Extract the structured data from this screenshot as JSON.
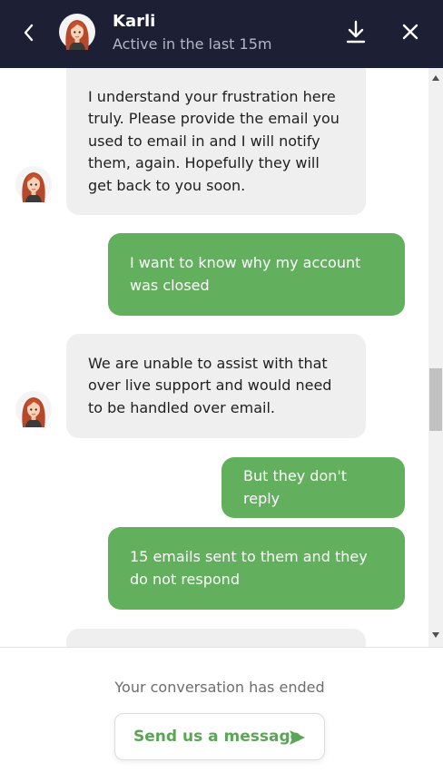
{
  "header": {
    "agent_name": "Karli",
    "status": "Active in the last 15m",
    "background_color": "#1d2035"
  },
  "messages": [
    {
      "sender": "agent",
      "text": "I understand your frustration here truly. Please provide the email you used to email in and I will notify them, again. Hopefully they will get back to you soon."
    },
    {
      "sender": "user",
      "text": "I want to know why my account was closed"
    },
    {
      "sender": "agent",
      "text": "We are unable to assist with that over live support and would need to be handled over email."
    },
    {
      "sender": "user",
      "text": "But they don't reply"
    },
    {
      "sender": "user",
      "text": "15 emails sent to them and they do not respond"
    },
    {
      "sender": "agent",
      "text": ""
    }
  ],
  "footer": {
    "ended_text": "Your conversation has ended",
    "send_button_label": "Send us a message"
  },
  "colors": {
    "user_bubble": "#62af5d",
    "agent_bubble": "#efefef",
    "accent": "#5aa656"
  },
  "icons": [
    "back-arrow-icon",
    "download-icon",
    "close-icon",
    "send-icon",
    "avatar"
  ]
}
